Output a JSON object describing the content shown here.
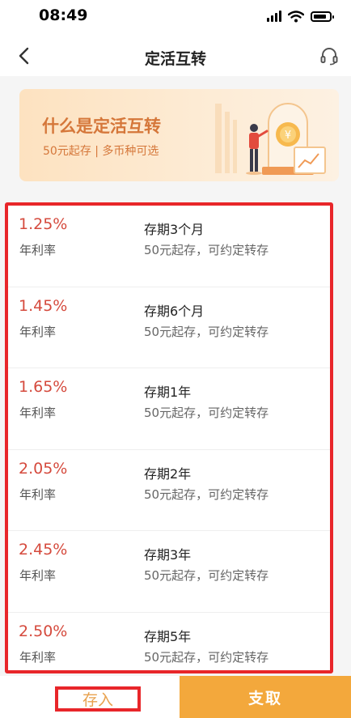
{
  "status": {
    "time": "08:49"
  },
  "nav": {
    "title": "定活互转",
    "back_icon": "chevron-left-icon",
    "service_icon": "headset-icon"
  },
  "banner": {
    "title": "什么是定活互转",
    "subtitle": "50元起存 | 多币种可选"
  },
  "rates": [
    {
      "rate": "1.25%",
      "label": "年利率",
      "term": "存期3个月",
      "desc": "50元起存，可约定转存"
    },
    {
      "rate": "1.45%",
      "label": "年利率",
      "term": "存期6个月",
      "desc": "50元起存，可约定转存"
    },
    {
      "rate": "1.65%",
      "label": "年利率",
      "term": "存期1年",
      "desc": "50元起存，可约定转存"
    },
    {
      "rate": "2.05%",
      "label": "年利率",
      "term": "存期2年",
      "desc": "50元起存，可约定转存"
    },
    {
      "rate": "2.45%",
      "label": "年利率",
      "term": "存期3年",
      "desc": "50元起存，可约定转存"
    },
    {
      "rate": "2.50%",
      "label": "年利率",
      "term": "存期5年",
      "desc": "50元起存，可约定转存"
    }
  ],
  "actions": {
    "deposit": "存入",
    "withdraw": "支取"
  },
  "colors": {
    "accent": "#f3a83c",
    "rate": "#d54a3d",
    "highlight": "#e8262a",
    "banner_text": "#d5773a"
  }
}
